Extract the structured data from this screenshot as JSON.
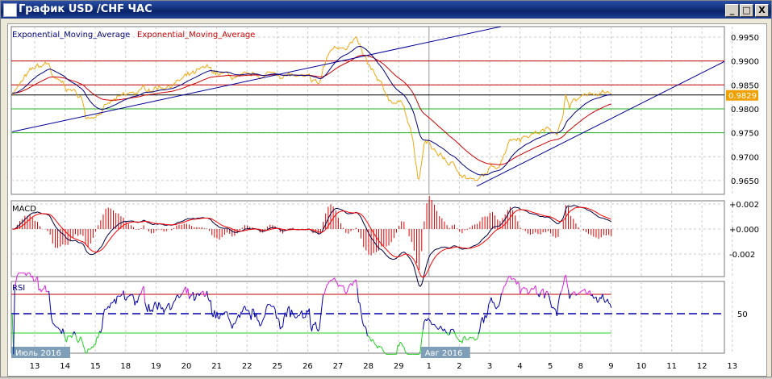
{
  "window": {
    "title": "График USD /CHF  ЧАС",
    "minimize": "_",
    "maximize": "□",
    "close": "X"
  },
  "legend": {
    "ema1": "Exponential_Moving_Average",
    "ema2": "Exponential_Moving_Average"
  },
  "colors": {
    "price": "#f0a810",
    "ema_fast": "#000080",
    "ema_slow": "#cc0000",
    "resist": "#c00000",
    "support": "#20b020",
    "trend": "#000099",
    "rsi_over": "#e020e0",
    "rsi_under": "#20d020"
  },
  "chart_data": {
    "type": "line",
    "title": "USD/CHF H1",
    "x_tick_labels": [
      "13",
      "14",
      "15",
      "18",
      "19",
      "20",
      "21",
      "22",
      "25",
      "26",
      "27",
      "28",
      "29",
      "1",
      "2",
      "3",
      "4",
      "5",
      "8",
      "9",
      "10",
      "11",
      "12",
      "13"
    ],
    "month_labels": [
      {
        "text": "Июль 2016",
        "day": 0
      },
      {
        "text": "Авг 2016",
        "day": 13
      }
    ],
    "price_axis": {
      "ticks": [
        "0.9950",
        "0.9900",
        "0.9850",
        "0.9800",
        "0.9750",
        "0.9700",
        "0.9650"
      ],
      "ylim": [
        0.9628,
        0.9978
      ]
    },
    "current_price": "0.9829",
    "price_series": [
      [
        -0.74,
        0.9835
      ],
      [
        -0.05,
        0.988
      ],
      [
        0.48,
        0.9895
      ],
      [
        0.61,
        0.986
      ],
      [
        1.54,
        0.9825
      ],
      [
        1.68,
        0.978
      ],
      [
        2.61,
        0.9815
      ],
      [
        3.67,
        0.984
      ],
      [
        4.6,
        0.9855
      ],
      [
        5.66,
        0.988
      ],
      [
        6.86,
        0.986
      ],
      [
        7.93,
        0.9875
      ],
      [
        8.46,
        0.987
      ],
      [
        9.39,
        0.985
      ],
      [
        9.52,
        0.9885
      ],
      [
        9.79,
        0.9925
      ],
      [
        10.59,
        0.9945
      ],
      [
        10.85,
        0.9905
      ],
      [
        11.25,
        0.986
      ],
      [
        11.65,
        0.982
      ],
      [
        12.18,
        0.981
      ],
      [
        12.45,
        0.9745
      ],
      [
        12.66,
        0.964
      ],
      [
        12.85,
        0.973
      ],
      [
        13.78,
        0.968
      ],
      [
        14.57,
        0.9645
      ],
      [
        14.84,
        0.966
      ],
      [
        15.37,
        0.969
      ],
      [
        15.64,
        0.974
      ],
      [
        16.44,
        0.975
      ],
      [
        17.23,
        0.976
      ],
      [
        17.42,
        0.978
      ],
      [
        17.5,
        0.9835
      ],
      [
        17.63,
        0.981
      ],
      [
        18.3,
        0.9835
      ],
      [
        19.02,
        0.983
      ]
    ],
    "horizontal_levels": {
      "resistance": [
        0.99,
        0.985
      ],
      "support": [
        0.98,
        0.975
      ],
      "current": 0.9829
    },
    "trend_lines": [
      [
        [
          -0.74,
          0.9752
        ],
        [
          15.37,
          0.9972
        ]
      ],
      [
        [
          14.57,
          0.9638
        ],
        [
          22.74,
          0.9899
        ]
      ]
    ],
    "macd": {
      "label": "MACD",
      "ticks": [
        "+0.002",
        "+0.000",
        "-0.002"
      ],
      "ylim": [
        -0.0026,
        0.0023
      ]
    },
    "rsi": {
      "label": "RSI",
      "tick": "50",
      "levels": [
        70,
        30
      ]
    }
  }
}
